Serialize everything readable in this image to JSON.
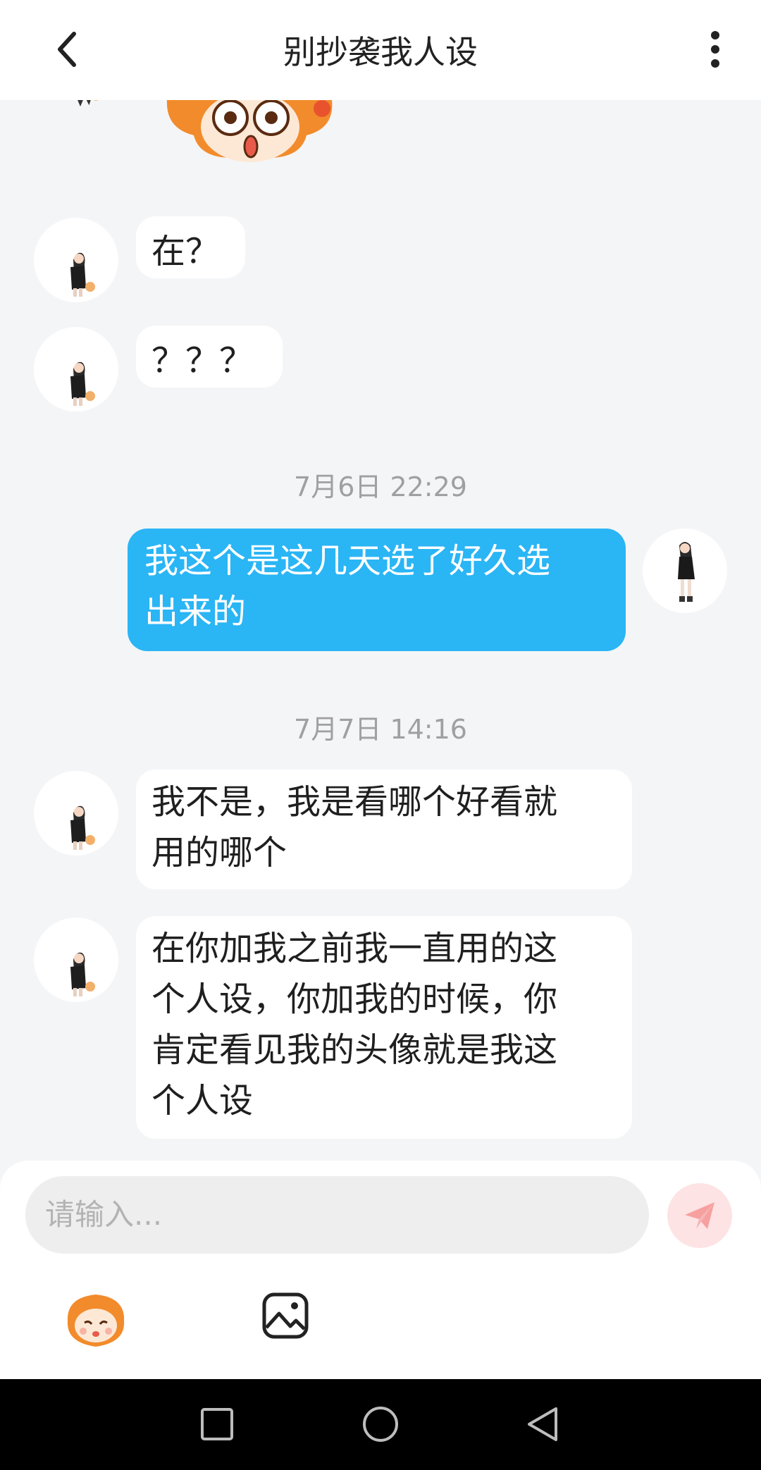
{
  "header": {
    "title": "别抄袭我人设",
    "back_icon": "chevron-left-icon",
    "more_icon": "more-vertical-icon"
  },
  "messages": [
    {
      "sender": "other",
      "text": "在？"
    },
    {
      "sender": "other",
      "text": "？？？"
    },
    {
      "time": "7月6日 22:29"
    },
    {
      "sender": "self",
      "line1": "我这个是这几天选了好久选",
      "line2": "出来的"
    },
    {
      "time": "7月7日 14:16"
    },
    {
      "sender": "other",
      "line1": "我不是，我是看哪个好看就",
      "line2": "用的哪个"
    },
    {
      "sender": "other",
      "line1": "在你加我之前我一直用的这",
      "line2": "个人设，你加我的时候，你",
      "line3": "肯定看见我的头像就是我这",
      "line4": "个人设"
    }
  ],
  "composer": {
    "placeholder": "请输入...",
    "send_icon": "send-icon",
    "emoji_icon": "emoji-sticker-icon",
    "image_icon": "image-icon"
  },
  "navbar": {
    "square_icon": "recent-apps-icon",
    "circle_icon": "home-icon",
    "triangle_icon": "back-triangle-icon"
  },
  "colors": {
    "self_bubble": "#2ab5f5",
    "background": "#f4f5f7",
    "send_button": "#fde3e3",
    "send_arrow": "#f7a0a0"
  }
}
